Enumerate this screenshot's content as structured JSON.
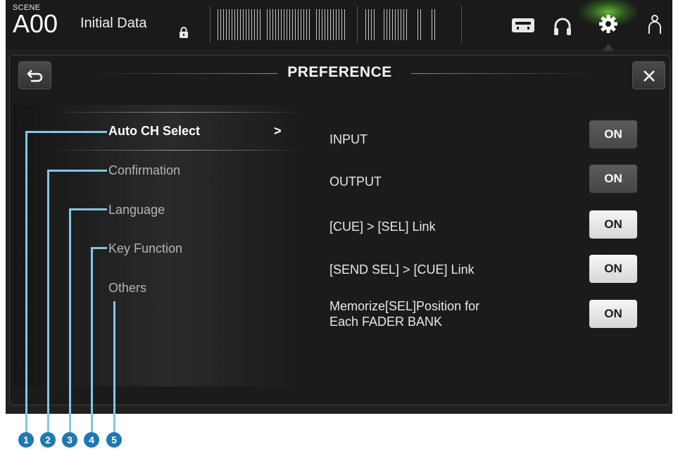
{
  "topbar": {
    "scene_label": "SCENE",
    "scene_number": "A00",
    "scene_name": "Initial Data",
    "icons": [
      "lock-icon",
      "recorder-icon",
      "headphones-icon",
      "settings-icon",
      "user-icon"
    ],
    "active_icon_color": "#7ed04a"
  },
  "panel": {
    "title": "PREFERENCE",
    "back_icon": "back-arrow-icon",
    "close_icon": "close-icon"
  },
  "menu": {
    "items": [
      {
        "label": "Auto CH Select",
        "selected": true
      },
      {
        "label": "Confirmation",
        "selected": false
      },
      {
        "label": "Language",
        "selected": false
      },
      {
        "label": "Key Function",
        "selected": false
      },
      {
        "label": "Others",
        "selected": false
      }
    ],
    "selected_arrow": ">"
  },
  "settings": {
    "rows": [
      {
        "label": "INPUT",
        "value": "ON"
      },
      {
        "label": "OUTPUT",
        "value": "ON"
      },
      {
        "label": "[CUE] > [SEL] Link",
        "value": "ON"
      },
      {
        "label": "[SEND SEL] > [CUE] Link",
        "value": "ON"
      },
      {
        "label_line1": "Memorize[SEL]Position for",
        "label_line2": "Each FADER BANK",
        "value": "ON"
      }
    ]
  },
  "callouts": [
    "1",
    "2",
    "3",
    "4",
    "5"
  ],
  "colors": {
    "callout_fill": "#1e78b4",
    "callout_line": "#7ec8ea",
    "on_dark": "#505050",
    "on_light": "#e6e6e6"
  }
}
